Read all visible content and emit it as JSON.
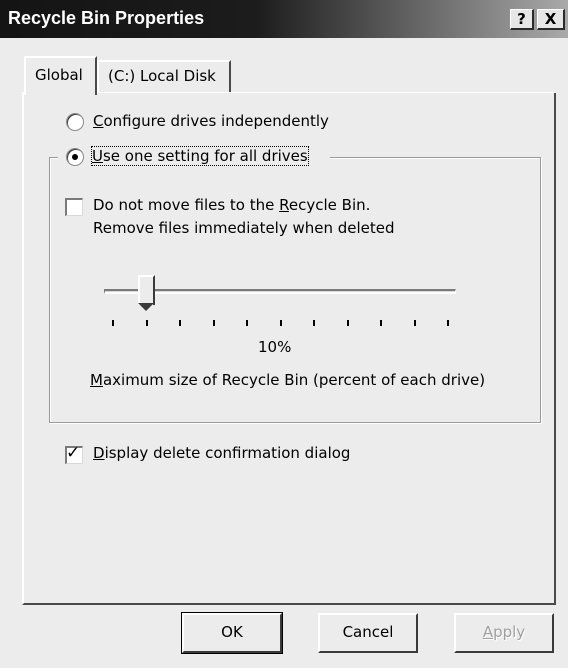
{
  "window": {
    "title": "Recycle Bin Properties",
    "help_button": "?",
    "close_button": "X"
  },
  "tabs": [
    {
      "label": "Global",
      "active": true
    },
    {
      "label": "(C:) Local Disk",
      "active": false
    }
  ],
  "options": {
    "configure_independently": {
      "prefix": "",
      "accel": "C",
      "rest": "onfigure drives independently",
      "selected": false
    },
    "use_one_setting": {
      "prefix": "",
      "accel": "U",
      "rest": "se one setting for all drives",
      "selected": true
    }
  },
  "group": {
    "do_not_move": {
      "line1_pre": "Do not move files to the ",
      "line1_accel": "R",
      "line1_post": "ecycle Bin.",
      "line2": "Remove files immediately when deleted",
      "checked": false
    },
    "slider": {
      "value_percent": 10,
      "value_label": "10%",
      "tick_count": 11
    },
    "slider_caption": {
      "accel": "M",
      "rest": "aximum size of Recycle Bin (percent of each drive)"
    }
  },
  "display_confirm": {
    "accel": "D",
    "rest": "isplay delete confirmation dialog",
    "checked": true
  },
  "buttons": {
    "ok": "OK",
    "cancel": "Cancel",
    "apply_accel": "A",
    "apply_rest": "pply"
  },
  "colors": {
    "titlebar_start": "#141414",
    "titlebar_end": "#a9a9a9",
    "face": "#ececec"
  }
}
